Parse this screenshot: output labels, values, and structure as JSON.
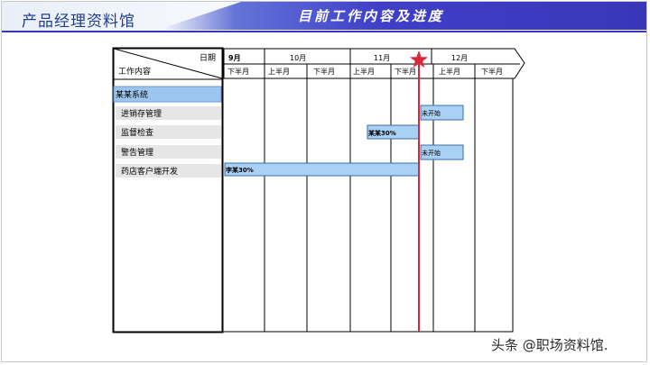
{
  "header": {
    "brand": "产品经理资料馆",
    "title": "目前工作内容及进度"
  },
  "table": {
    "corner_top": "日期",
    "corner_bottom": "工作内容",
    "months": [
      "9月",
      "10月",
      "11月",
      "12月"
    ],
    "halves": [
      "下半月",
      "上半月",
      "下半月",
      "上半月",
      "下半月",
      "上半月",
      "下半月"
    ],
    "group": "某某系统",
    "tasks": [
      {
        "name": "进销存管理",
        "bar_label": "未开始"
      },
      {
        "name": "监督检查",
        "bar_label": "某某30%"
      },
      {
        "name": "警告管理",
        "bar_label": "未开始"
      },
      {
        "name": "药店客户端开发",
        "bar_label": "李某30%"
      }
    ]
  },
  "colors": {
    "header_bar": "#3a36b8",
    "brand_text": "#1f3f8c",
    "group_fill": "#9cc6ee",
    "task_fill": "#e6e6e6",
    "bar_fill": "#a9d0f5",
    "today_line": "#d8283a"
  },
  "icons": {
    "today_marker": "star-icon"
  },
  "watermark": "头条 @职场资料馆."
}
